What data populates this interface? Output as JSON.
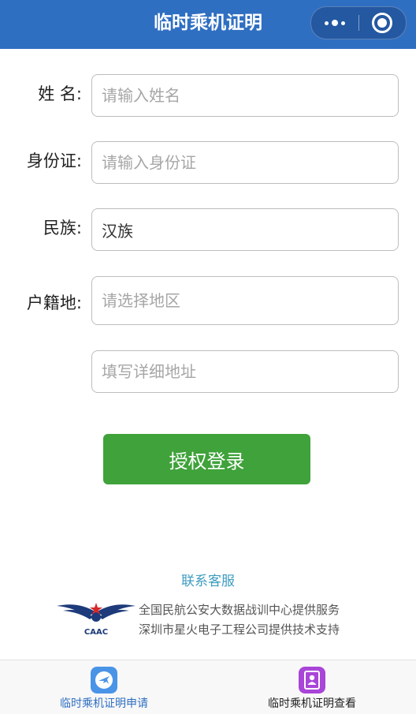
{
  "header": {
    "title": "临时乘机证明"
  },
  "form": {
    "name": {
      "label": "姓 名:",
      "placeholder": "请输入姓名"
    },
    "id_card": {
      "label": "身份证:",
      "placeholder": "请输入身份证"
    },
    "ethnicity": {
      "label": "民族:",
      "value": "汉族"
    },
    "domicile": {
      "label": "户籍地:",
      "region_placeholder": "请选择地区",
      "address_placeholder": "填写详细地址"
    }
  },
  "login_button": "授权登录",
  "footer": {
    "contact": "联系客服",
    "logo_text": "CAAC",
    "line1": "全国民航公安大数据战训中心提供服务",
    "line2": "深圳市星火电子工程公司提供技术支持"
  },
  "tabbar": {
    "apply": {
      "label": "临时乘机证明申请",
      "color": "#2f6fc2",
      "icon_color": "#4a94e8",
      "icon": "airplane-icon"
    },
    "view": {
      "label": "临时乘机证明查看",
      "color": "#222222",
      "icon_color": "#a945d8",
      "icon": "person-card-icon"
    }
  }
}
